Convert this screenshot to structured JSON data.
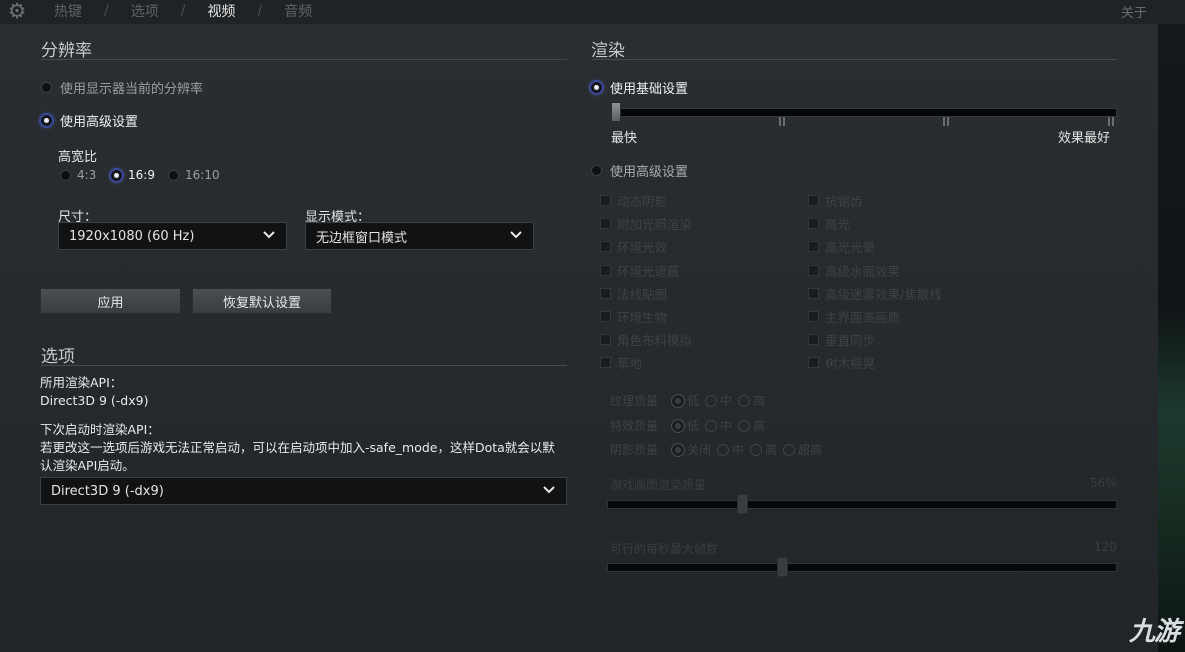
{
  "topbar": {
    "tabs": [
      "热键",
      "选项",
      "视频",
      "音频"
    ],
    "active_tab": "视频",
    "about": "关于"
  },
  "resolution": {
    "title": "分辨率",
    "use_monitor": "使用显示器当前的分辨率",
    "use_advanced": "使用高级设置",
    "aspect_label": "高宽比",
    "aspects": [
      "4:3",
      "16:9",
      "16:10"
    ],
    "aspect_selected": "16:9",
    "size_label": "尺寸：",
    "size_value": "1920x1080 (60 Hz)",
    "mode_label": "显示模式：",
    "mode_value": "无边框窗口模式",
    "apply": "应用",
    "restore": "恢复默认设置"
  },
  "options": {
    "title": "选项",
    "api_label": "所用渲染API：",
    "api_value": "Direct3D 9 (-dx9)",
    "next_label": "下次启动时渲染API：",
    "note": "若更改这一选项后游戏无法正常启动，可以在启动项中加入-safe_mode，这样Dota就会以默认渲染API启动。",
    "next_value": "Direct3D 9 (-dx9)"
  },
  "render": {
    "title": "渲染",
    "basic": "使用基础设置",
    "slider_min": "最快",
    "slider_max": "效果最好",
    "slider_level_fraction": 0,
    "advanced": "使用高级设置",
    "checks_left": [
      "动态阴影",
      "附加光照渲染",
      "环境光效",
      "环境光遮蔽",
      "法线贴图",
      "环境生物",
      "角色布料模拟",
      "草地"
    ],
    "checks_right": [
      "抗锯齿",
      "高光",
      "高光光晕",
      "高级水面效果",
      "高级迷雾效果/焦散线",
      "主界面高画质",
      "垂直同步",
      "树木摇晃"
    ],
    "texture_label": "纹理质量",
    "effect_label": "特效质量",
    "shadow_label": "阴影质量",
    "q_low": "低",
    "q_mid": "中",
    "q_high": "高",
    "q_off": "关闭",
    "q_ultra": "超高",
    "render_quality_label": "游戏画面渲染质量",
    "render_quality_value": "56%",
    "render_quality_fraction": 0.26,
    "fps_label": "可行的每秒最大帧数",
    "fps_value": "120",
    "fps_fraction": 0.34
  },
  "watermark": "九游",
  "colors": {
    "accent_radio": "#5a6fd0",
    "text": "#e4e4e4",
    "dim": "#3e4246"
  }
}
